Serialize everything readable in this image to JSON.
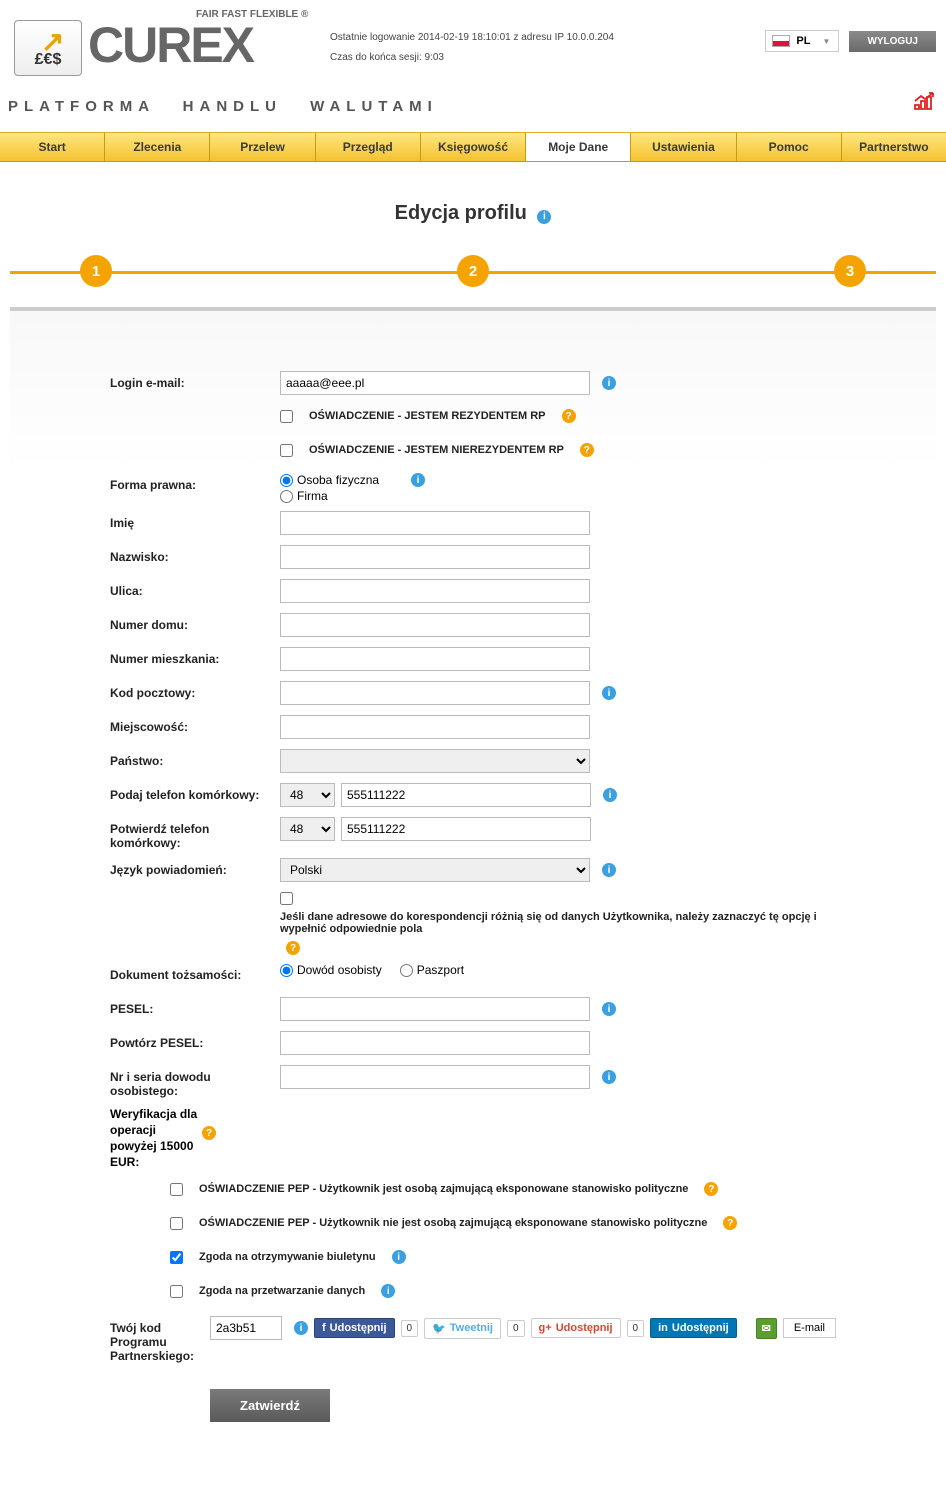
{
  "header": {
    "logo_mark": "£€$",
    "logo_text": "CUREX",
    "slogan": "FAIR FAST FLEXIBLE ®",
    "tagline": "PLATFORMA HANDLU WALUTAMI",
    "last_login": "Ostatnie logowanie 2014-02-19 18:10:01 z adresu IP 10.0.0.204",
    "session_time": "Czas do końca sesji: 9:03",
    "lang": "PL",
    "logout": "WYLOGUJ"
  },
  "nav": {
    "items": [
      "Start",
      "Zlecenia",
      "Przelew",
      "Przegląd",
      "Księgowość",
      "Moje Dane",
      "Ustawienia",
      "Pomoc",
      "Partnerstwo"
    ],
    "active_index": 5
  },
  "page": {
    "title": "Edycja profilu"
  },
  "steps": [
    "1",
    "2",
    "3"
  ],
  "form": {
    "login_label": "Login e-mail:",
    "login_value": "aaaaa@eee.pl",
    "decl_resident": "OŚWIADCZENIE - JESTEM REZYDENTEM RP",
    "decl_nonresident": "OŚWIADCZENIE - JESTEM NIEREZYDENTEM RP",
    "legal_form_label": "Forma prawna:",
    "legal_opt1": "Osoba fizyczna",
    "legal_opt2": "Firma",
    "firstname_label": "Imię",
    "lastname_label": "Nazwisko:",
    "street_label": "Ulica:",
    "house_no_label": "Numer domu:",
    "apt_no_label": "Numer mieszkania:",
    "postal_label": "Kod pocztowy:",
    "city_label": "Miejscowość:",
    "country_label": "Państwo:",
    "mobile_label": "Podaj telefon komórkowy:",
    "mobile_prefix": "48",
    "mobile_number": "555111222",
    "mobile_confirm_label": "Potwierdź telefon komórkowy:",
    "mobile_confirm_prefix": "48",
    "mobile_confirm_number": "555111222",
    "lang_label": "Język powiadomień:",
    "lang_value": "Polski",
    "corr_note": "Jeśli dane adresowe do korespondencji różnią się od danych Użytkownika, należy zaznaczyć tę opcję i wypełnić odpowiednie pola",
    "id_doc_label": "Dokument tożsamości:",
    "id_opt1": "Dowód osobisty",
    "id_opt2": "Paszport",
    "pesel_label": "PESEL:",
    "pesel_repeat_label": "Powtórz PESEL:",
    "id_series_label": "Nr i seria dowodu osobistego:",
    "verification_label": "Weryfikacja dla operacji powyżej 15000 EUR:",
    "pep_yes": "OŚWIADCZENIE PEP - Użytkownik jest osobą zajmującą eksponowane stanowisko polityczne",
    "pep_no": "OŚWIADCZENIE PEP - Użytkownik nie jest osobą zajmującą eksponowane stanowisko polityczne",
    "newsletter": "Zgoda na otrzymywanie biuletynu",
    "data_processing": "Zgoda na przetwarzanie danych",
    "partner_code_label": "Twój kod Programu Partnerskiego:",
    "partner_code": "2a3b51",
    "submit": "Zatwierdź"
  },
  "share": {
    "fb": "Udostępnij",
    "fb_count": "0",
    "tw": "Tweetnij",
    "tw_count": "0",
    "gp": "Udostępnij",
    "gp_count": "0",
    "li": "Udostępnij",
    "em": "E-mail"
  }
}
